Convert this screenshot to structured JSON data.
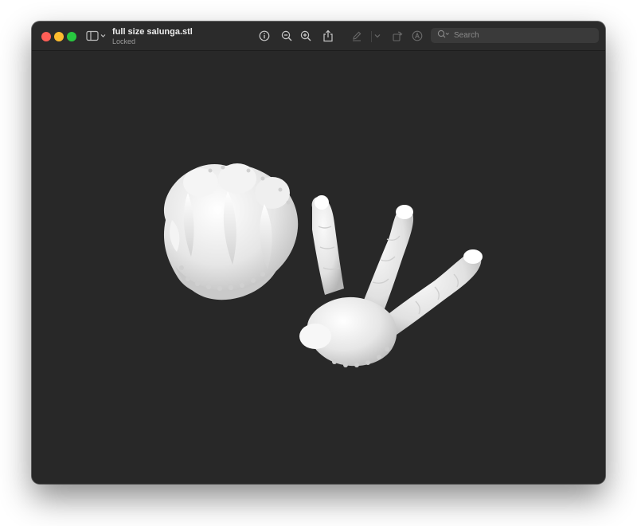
{
  "window": {
    "title": "full size salunga.stl",
    "subtitle": "Locked"
  },
  "toolbar": {
    "items": [
      {
        "name": "sidebar-toggle",
        "icon": "sidebar-icon"
      },
      {
        "name": "info",
        "icon": "info-icon"
      },
      {
        "name": "zoom-out",
        "icon": "zoom-out-icon"
      },
      {
        "name": "zoom-in",
        "icon": "zoom-in-icon"
      },
      {
        "name": "share",
        "icon": "share-icon"
      },
      {
        "name": "markup",
        "icon": "pencil-icon"
      },
      {
        "name": "markup-menu",
        "icon": "chevron-down-icon"
      },
      {
        "name": "rotate",
        "icon": "rotate-icon"
      },
      {
        "name": "annotate",
        "icon": "annotate-icon"
      }
    ]
  },
  "search": {
    "placeholder": "Search"
  },
  "colors": {
    "background": "#282828",
    "titlebar": "#2b2b2b",
    "model": "#f2f2f2",
    "close": "#ff5f57",
    "minimize": "#febc2e",
    "zoom": "#28c840"
  },
  "viewport": {
    "content": "3D model preview of two claw models"
  }
}
